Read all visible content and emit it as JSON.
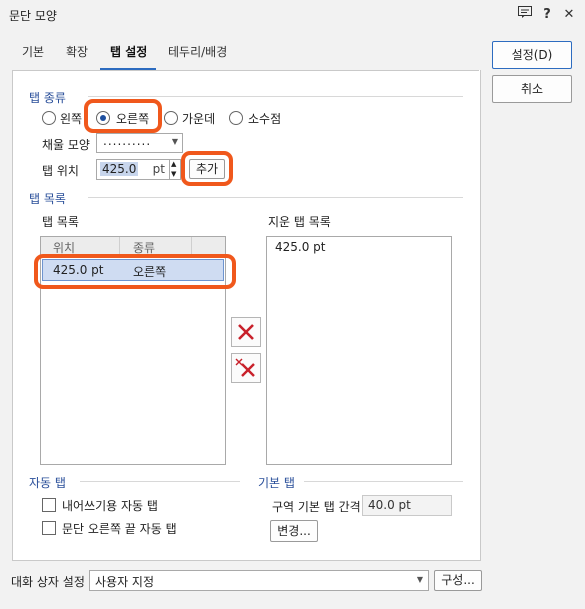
{
  "window": {
    "title": "문단 모양"
  },
  "tabs": [
    "기본",
    "확장",
    "탭 설정",
    "테두리/배경"
  ],
  "buttons": {
    "ok": "설정(D)",
    "cancel": "취소",
    "add": "추가",
    "change": "변경...",
    "config": "구성..."
  },
  "tab_type": {
    "title": "탭 종류",
    "options": [
      "왼쪽",
      "오른쪽",
      "가운데",
      "소수점"
    ],
    "selected": "오른쪽",
    "fill_label": "채울 모양",
    "fill_value": "..........",
    "position_label": "탭 위치",
    "position_value": "425.0",
    "unit": "pt"
  },
  "tab_list": {
    "title": "탭 목록",
    "list_label": "탭 목록",
    "col_pos": "위치",
    "col_type": "종류",
    "rows": [
      {
        "pos": "425.0 pt",
        "type": "오른쪽"
      }
    ],
    "deleted_label": "지운 탭 목록",
    "deleted_rows": [
      "425.0 pt"
    ]
  },
  "auto_tab": {
    "title": "자동 탭",
    "opt1": "내어쓰기용 자동 탭",
    "opt2": "문단 오른쪽 끝 자동 탭"
  },
  "default_tab": {
    "title": "기본 탭",
    "interval_label": "구역 기본 탭 간격",
    "interval_value": "40.0 pt"
  },
  "footer": {
    "label": "대화 상자 설정",
    "value": "사용자 지정"
  },
  "colors": {
    "accent": "#2d6cc0",
    "highlight": "#f0581c",
    "delete_red": "#c8202a"
  }
}
